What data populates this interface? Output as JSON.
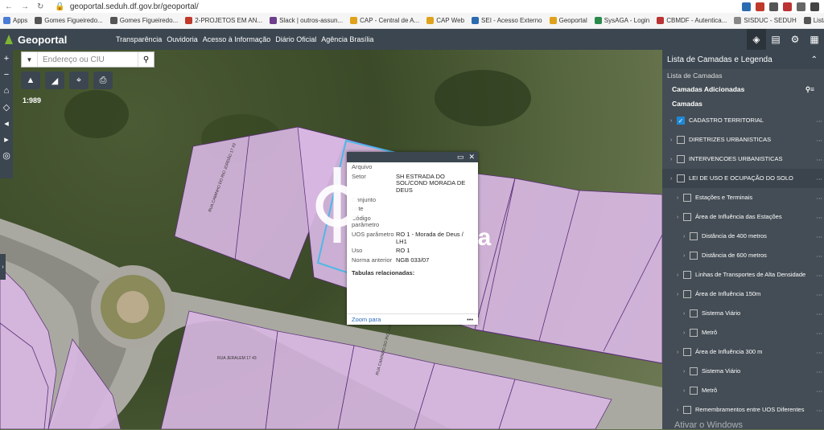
{
  "browser": {
    "url": "geoportal.seduh.df.gov.br/geoportal/"
  },
  "bookmarks": [
    {
      "label": "Apps",
      "color": "#4a7bd6"
    },
    {
      "label": "Gomes Figueiredo...",
      "color": "#555"
    },
    {
      "label": "Gomes Figueiredo...",
      "color": "#555"
    },
    {
      "label": "2-PROJETOS EM AN...",
      "color": "#c0392b"
    },
    {
      "label": "Slack | outros-assun...",
      "color": "#6d3f8c"
    },
    {
      "label": "CAP - Central de A...",
      "color": "#e0a21b"
    },
    {
      "label": "CAP Web",
      "color": "#e0a21b"
    },
    {
      "label": "SEI - Acesso Externo",
      "color": "#2b6cb0"
    },
    {
      "label": "Geoportal",
      "color": "#e0a21b"
    },
    {
      "label": "SysAGA - Login",
      "color": "#2a8a4a"
    },
    {
      "label": "CBMDF - Autentica...",
      "color": "#b33"
    },
    {
      "label": "SISDUC - SEDUH",
      "color": "#888"
    },
    {
      "label": "Lista de leit",
      "color": "#555"
    }
  ],
  "app": {
    "title": "Geoportal",
    "menu": [
      "Transparência",
      "Ouvidoria",
      "Acesso à Informação",
      "Diário Oficial",
      "Agência Brasília"
    ]
  },
  "search": {
    "placeholder": "Endereço ou CIU"
  },
  "map": {
    "scale": "1:989"
  },
  "popup": {
    "rows": [
      {
        "k": "Arquivo",
        "v": ""
      },
      {
        "k": "Setor",
        "v": "SH ESTRADA DO SOL/COND MORADA DE DEUS"
      },
      {
        "k": "Conjunto",
        "v": ""
      },
      {
        "k": "Lote",
        "v": ""
      },
      {
        "k": "Código parâmetro",
        "v": ""
      },
      {
        "k": "UOS parâmetro",
        "v": "RO 1 - Morada de Deus / LH1"
      },
      {
        "k": "Uso",
        "v": "RO 1"
      },
      {
        "k": "Norma anterior",
        "v": "NGB 033/07"
      }
    ],
    "related": "Tabulas relacionadas:",
    "zoom": "Zoom para",
    "more": "•••"
  },
  "watermark": {
    "text": "lia"
  },
  "parcels": [
    {
      "label": "RUA CAMINHO DO RIO JORDÃO 17 43"
    },
    {
      "label": "RUA JERALEM 17 43"
    },
    {
      "label": "RUA CAMINHO DO RIO JORDÃO 17 45"
    }
  ],
  "panel": {
    "title": "Lista de Camadas e Legenda",
    "subtitle": "Lista de Camadas",
    "added": "Camadas Adicionadas",
    "layers_title": "Camadas",
    "items": [
      {
        "label": "CADASTRO TERRITORIAL",
        "checked": true,
        "indent": 0
      },
      {
        "label": "DIRETRIZES URBANISTICAS",
        "checked": false,
        "indent": 0
      },
      {
        "label": "INTERVENCOES URBANISTICAS",
        "checked": false,
        "indent": 0
      },
      {
        "label": "LEI DE USO E OCUPAÇÃO DO SOLO",
        "checked": false,
        "indent": 0,
        "highlight": true
      },
      {
        "label": "Estações e Terminais",
        "checked": false,
        "indent": 1
      },
      {
        "label": "Área de Influência das Estações",
        "checked": false,
        "indent": 1
      },
      {
        "label": "Distância de 400 metros",
        "checked": false,
        "indent": 2
      },
      {
        "label": "Distância de 600 metros",
        "checked": false,
        "indent": 2
      },
      {
        "label": "Linhas de Transportes de Alta Densidade",
        "checked": false,
        "indent": 1
      },
      {
        "label": "Área de Influência 150m",
        "checked": false,
        "indent": 1
      },
      {
        "label": "Sistema Viário",
        "checked": false,
        "indent": 2
      },
      {
        "label": "Metrô",
        "checked": false,
        "indent": 2
      },
      {
        "label": "Área de Influência 300 m",
        "checked": false,
        "indent": 1
      },
      {
        "label": "Sistema Viário",
        "checked": false,
        "indent": 2
      },
      {
        "label": "Metrô",
        "checked": false,
        "indent": 2
      },
      {
        "label": "Remembramentos entre UOS Diferentes",
        "checked": false,
        "indent": 1
      }
    ]
  },
  "os": {
    "activate": "Ativar o Windows"
  }
}
